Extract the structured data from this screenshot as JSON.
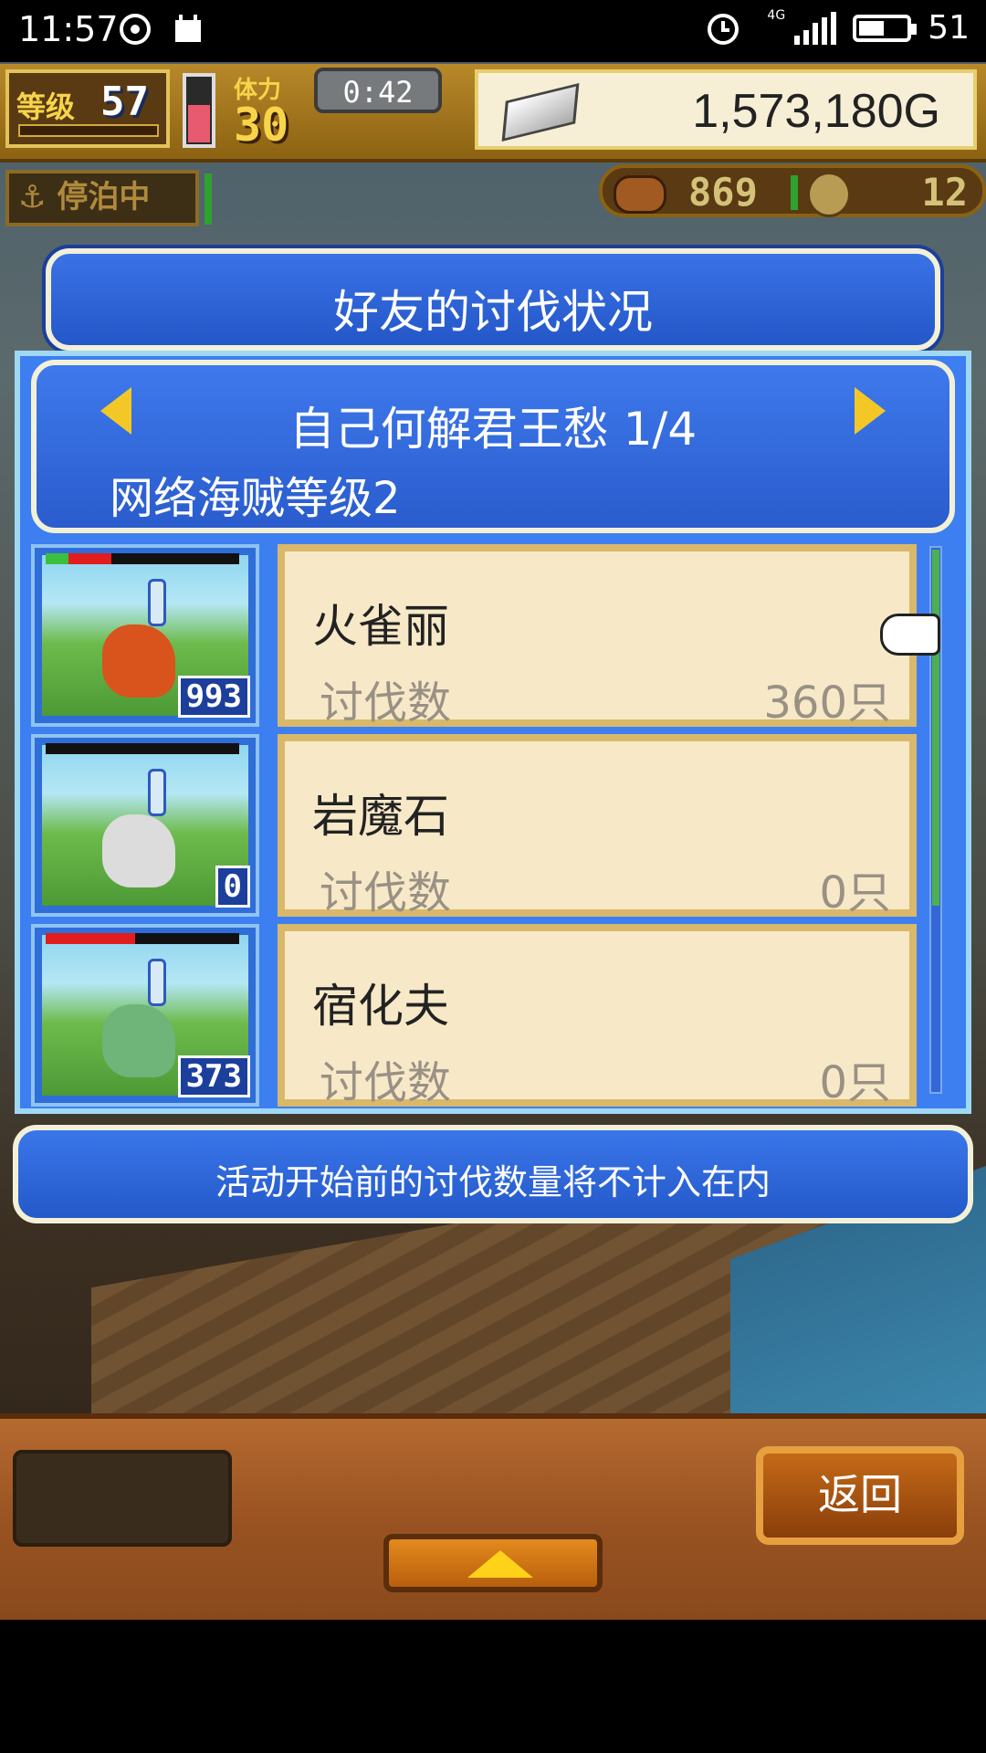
{
  "status_bar": {
    "time": "11:57",
    "network": "4G",
    "battery": "51",
    "battery_level": 0.51
  },
  "hud": {
    "level_label": "等级",
    "level": "57",
    "stamina_label": "体力",
    "stamina": "30",
    "stamina_level": 0.55,
    "timer": "0:42",
    "gold": "1,573,180G",
    "anchor_status": "停泊中",
    "food": "869",
    "coins": "12"
  },
  "dialog": {
    "title": "好友的讨伐状况",
    "header_title": "自己何解君王愁 1/4",
    "header_sub": "网络海贼等级2",
    "rows": [
      {
        "name": "火雀丽",
        "label": "讨伐数",
        "count": "360只",
        "badge": "993",
        "hp_green": 0.12,
        "hp_red": 0.22,
        "color": "#d8541c"
      },
      {
        "name": "岩魔石",
        "label": "讨伐数",
        "count": "0只",
        "badge": "0",
        "hp_green": 0,
        "hp_red": 0,
        "color": "#dcdcdc"
      },
      {
        "name": "宿化夫",
        "label": "讨伐数",
        "count": "0只",
        "badge": "373",
        "hp_green": 0,
        "hp_red": 0.46,
        "color": "#6fb57a"
      }
    ],
    "notice": "活动开始前的讨伐数量将不计入在内"
  },
  "bottom": {
    "back_label": "返回"
  },
  "colors": {
    "panel_blue": "#2a5ccd",
    "card_bg": "#f7e9c8",
    "accent_yellow": "#f3c826"
  }
}
